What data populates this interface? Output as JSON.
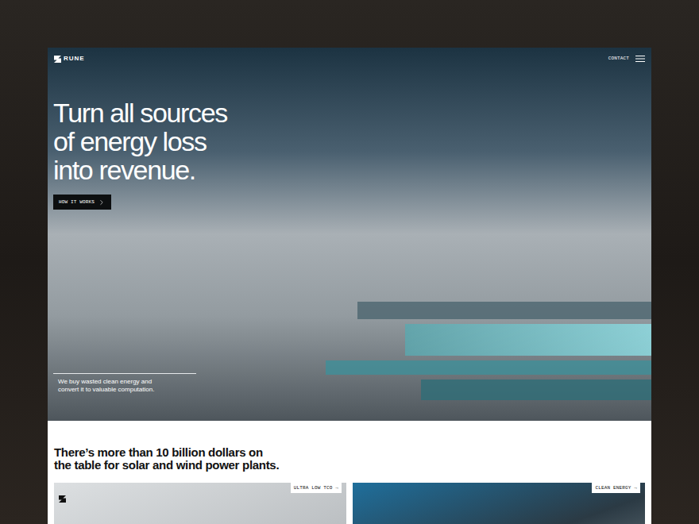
{
  "nav": {
    "logo": "RUNE",
    "links": [
      "CONTACT"
    ]
  },
  "hero": {
    "headline": [
      "Turn all sources",
      "of energy loss",
      "into revenue."
    ],
    "button": {
      "label": "HOW IT WORKS"
    },
    "caption": "We buy wasted clean energy and convert it to valuable computation."
  },
  "section": {
    "heading": [
      "There’s more than 10 billion dollars on",
      "the table for solar and wind power plants."
    ]
  },
  "cards": [
    {
      "label": "ULTRA LOW TCO →",
      "kind": "light"
    },
    {
      "label": "CLEAN ENERGY →",
      "kind": "dark"
    }
  ]
}
